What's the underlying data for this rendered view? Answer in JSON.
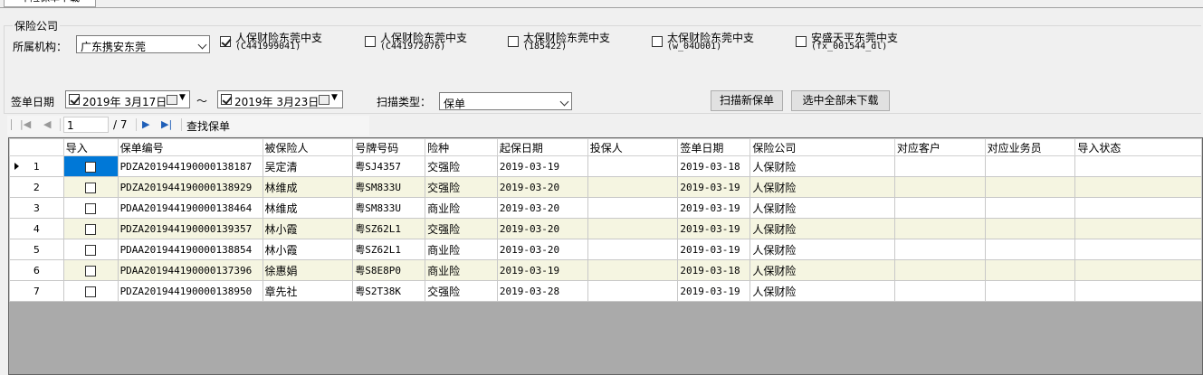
{
  "tab": {
    "label": "车险保单下载"
  },
  "insurer_group": {
    "title": "保险公司"
  },
  "org": {
    "label": "所属机构：",
    "value": "广东携安东莞"
  },
  "insurers": [
    {
      "name": "人保财险东莞中支",
      "code": "(C441999041)",
      "checked": true
    },
    {
      "name": "人保财险东莞中支",
      "code": "(C441972076)",
      "checked": false
    },
    {
      "name": "太保财险东莞中支",
      "code": "(185422)",
      "checked": false
    },
    {
      "name": "太保财险东莞中支",
      "code": "(w_04U001)",
      "checked": false
    },
    {
      "name": "安盛天平东莞中支",
      "code": "(fx_001544_dl)",
      "checked": false
    }
  ],
  "date": {
    "label": "签单日期",
    "from": "2019年  3月17日",
    "sep": "～",
    "to": "2019年  3月23日"
  },
  "scan": {
    "label": "扫描类型：",
    "value": "保单"
  },
  "buttons": {
    "scan_new": "扫描新保单",
    "download_all": "选中全部未下载"
  },
  "navigator": {
    "position": "1",
    "total": "/ 7",
    "find": "查找保单"
  },
  "columns": [
    "导入",
    "保单编号",
    "被保险人",
    "号牌号码",
    "险种",
    "起保日期",
    "投保人",
    "签单日期",
    "保险公司",
    "对应客户",
    "对应业务员",
    "导入状态"
  ],
  "rows": [
    {
      "n": "1",
      "policy": "PDZA201944190000138187",
      "insured": "吴定清",
      "plate": "粤SJ4357",
      "type": "交强险",
      "start": "2019-03-19",
      "holder": "",
      "sign": "2019-03-18",
      "company": "人保财险",
      "customer": "",
      "agent": "",
      "status": ""
    },
    {
      "n": "2",
      "policy": "PDZA201944190000138929",
      "insured": "林维成",
      "plate": "粤SM833U",
      "type": "交强险",
      "start": "2019-03-20",
      "holder": "",
      "sign": "2019-03-19",
      "company": "人保财险",
      "customer": "",
      "agent": "",
      "status": ""
    },
    {
      "n": "3",
      "policy": "PDAA201944190000138464",
      "insured": "林维成",
      "plate": "粤SM833U",
      "type": "商业险",
      "start": "2019-03-20",
      "holder": "",
      "sign": "2019-03-19",
      "company": "人保财险",
      "customer": "",
      "agent": "",
      "status": ""
    },
    {
      "n": "4",
      "policy": "PDZA201944190000139357",
      "insured": "林小霞",
      "plate": "粤SZ62L1",
      "type": "交强险",
      "start": "2019-03-20",
      "holder": "",
      "sign": "2019-03-19",
      "company": "人保财险",
      "customer": "",
      "agent": "",
      "status": ""
    },
    {
      "n": "5",
      "policy": "PDAA201944190000138854",
      "insured": "林小霞",
      "plate": "粤SZ62L1",
      "type": "商业险",
      "start": "2019-03-20",
      "holder": "",
      "sign": "2019-03-19",
      "company": "人保财险",
      "customer": "",
      "agent": "",
      "status": ""
    },
    {
      "n": "6",
      "policy": "PDAA201944190000137396",
      "insured": "徐惠娟",
      "plate": "粤S8E8P0",
      "type": "商业险",
      "start": "2019-03-19",
      "holder": "",
      "sign": "2019-03-18",
      "company": "人保财险",
      "customer": "",
      "agent": "",
      "status": ""
    },
    {
      "n": "7",
      "policy": "PDZA201944190000138950",
      "insured": "章先社",
      "plate": "粤S2T38K",
      "type": "交强险",
      "start": "2019-03-28",
      "holder": "",
      "sign": "2019-03-19",
      "company": "人保财险",
      "customer": "",
      "agent": "",
      "status": ""
    }
  ],
  "colors": {
    "selection": "#0078d7",
    "alt_row": "#f5f5e1",
    "grid_bg": "#aaaaaa"
  }
}
